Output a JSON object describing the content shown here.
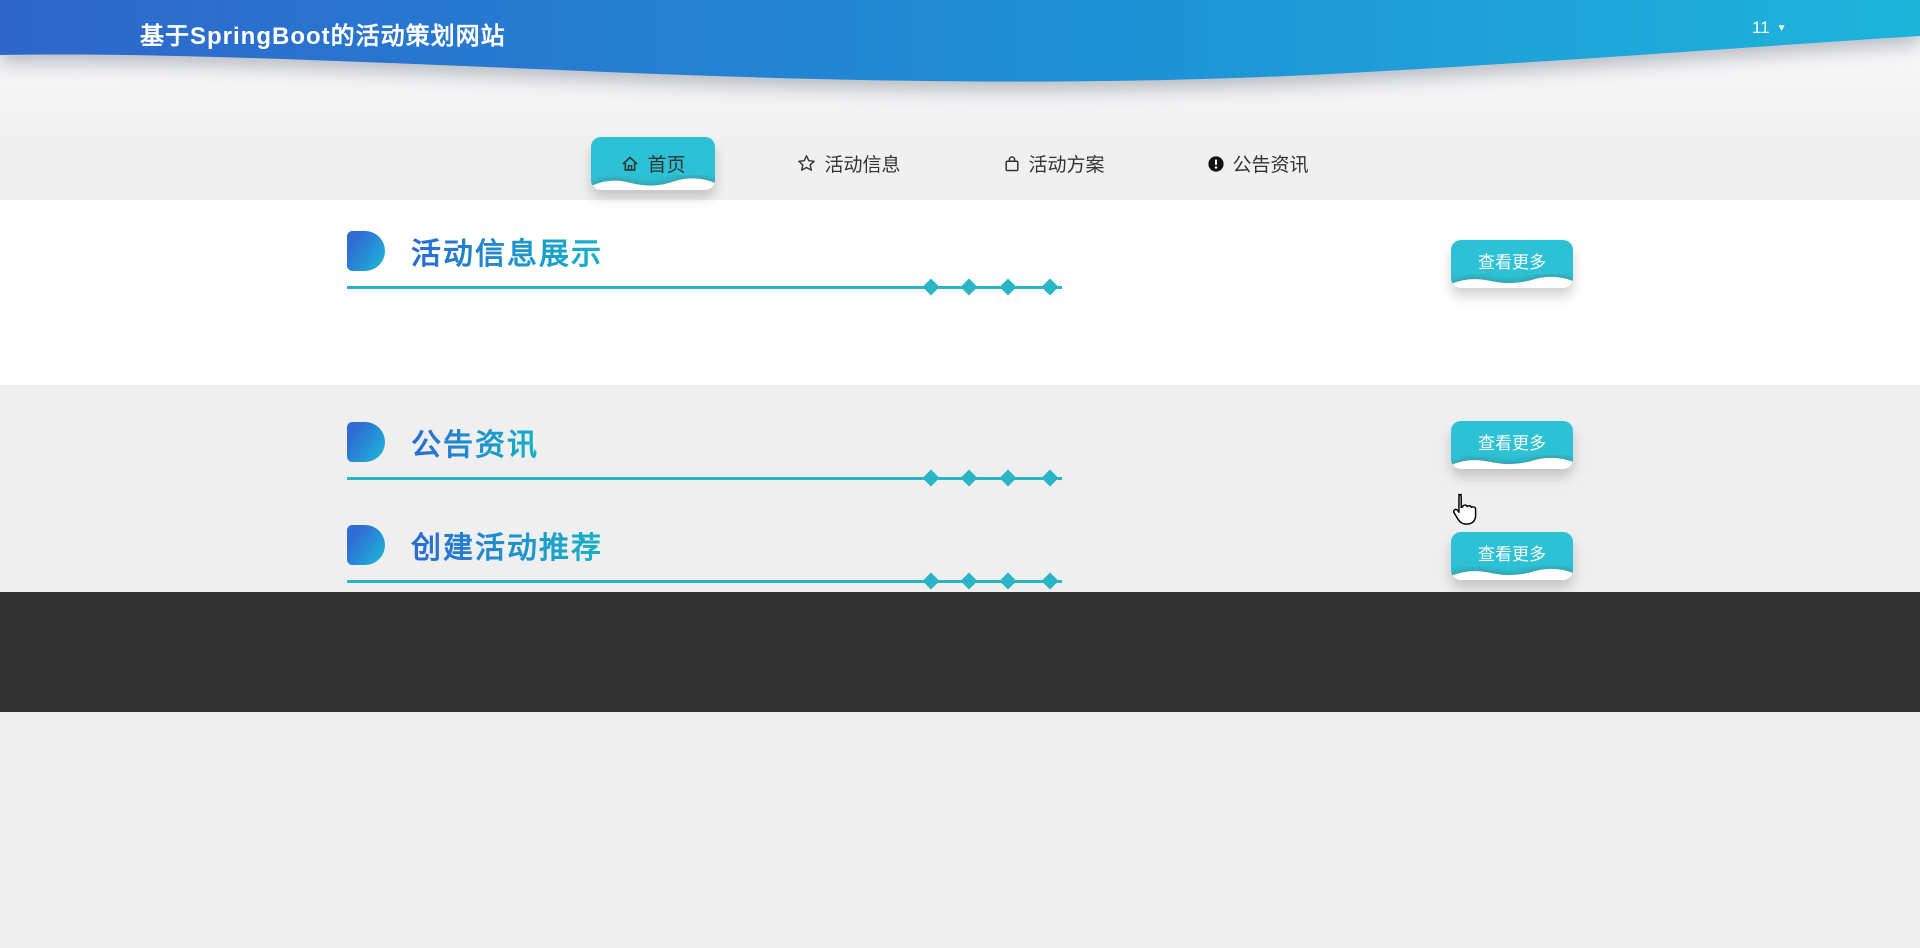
{
  "header": {
    "title": "基于SpringBoot的活动策划网站",
    "user_label": "11",
    "caret": "▼"
  },
  "nav": {
    "tabs": [
      {
        "label": "首页",
        "icon": "home-icon",
        "active": true
      },
      {
        "label": "活动信息",
        "icon": "star-icon",
        "active": false
      },
      {
        "label": "活动方案",
        "icon": "bag-icon",
        "active": false
      },
      {
        "label": "公告资讯",
        "icon": "info-icon",
        "active": false
      }
    ]
  },
  "sections": [
    {
      "title": "活动信息展示",
      "more_label": "查看更多"
    },
    {
      "title": "公告资讯",
      "more_label": "查看更多"
    },
    {
      "title": "创建活动推荐",
      "more_label": "查看更多"
    }
  ],
  "colors": {
    "header_gradient_start": "#2e66cb",
    "header_gradient_end": "#1db4da",
    "accent_cyan": "#2cc1d4",
    "title_gradient_start": "#2a6bd2",
    "title_gradient_end": "#14b4c6",
    "line_teal": "#28b5c6",
    "footer_dark": "#323232",
    "page_background": "#efeff0",
    "section_white": "#ffffff"
  }
}
